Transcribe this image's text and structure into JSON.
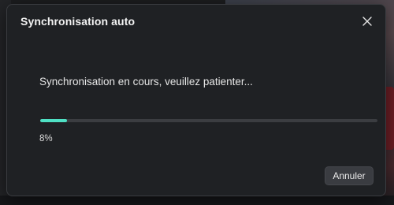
{
  "dialog": {
    "title": "Synchronisation auto",
    "message": "Synchronisation en cours, veuillez patienter...",
    "progress": {
      "percent_value": 8,
      "percent_text": "8%",
      "fill_color": "#4fe0c4",
      "track_color": "#3b3d41"
    },
    "cancel_label": "Annuler",
    "close_icon": "close-icon"
  },
  "colors": {
    "dialog_background": "#1f2124",
    "accent": "#4fe0c4"
  }
}
